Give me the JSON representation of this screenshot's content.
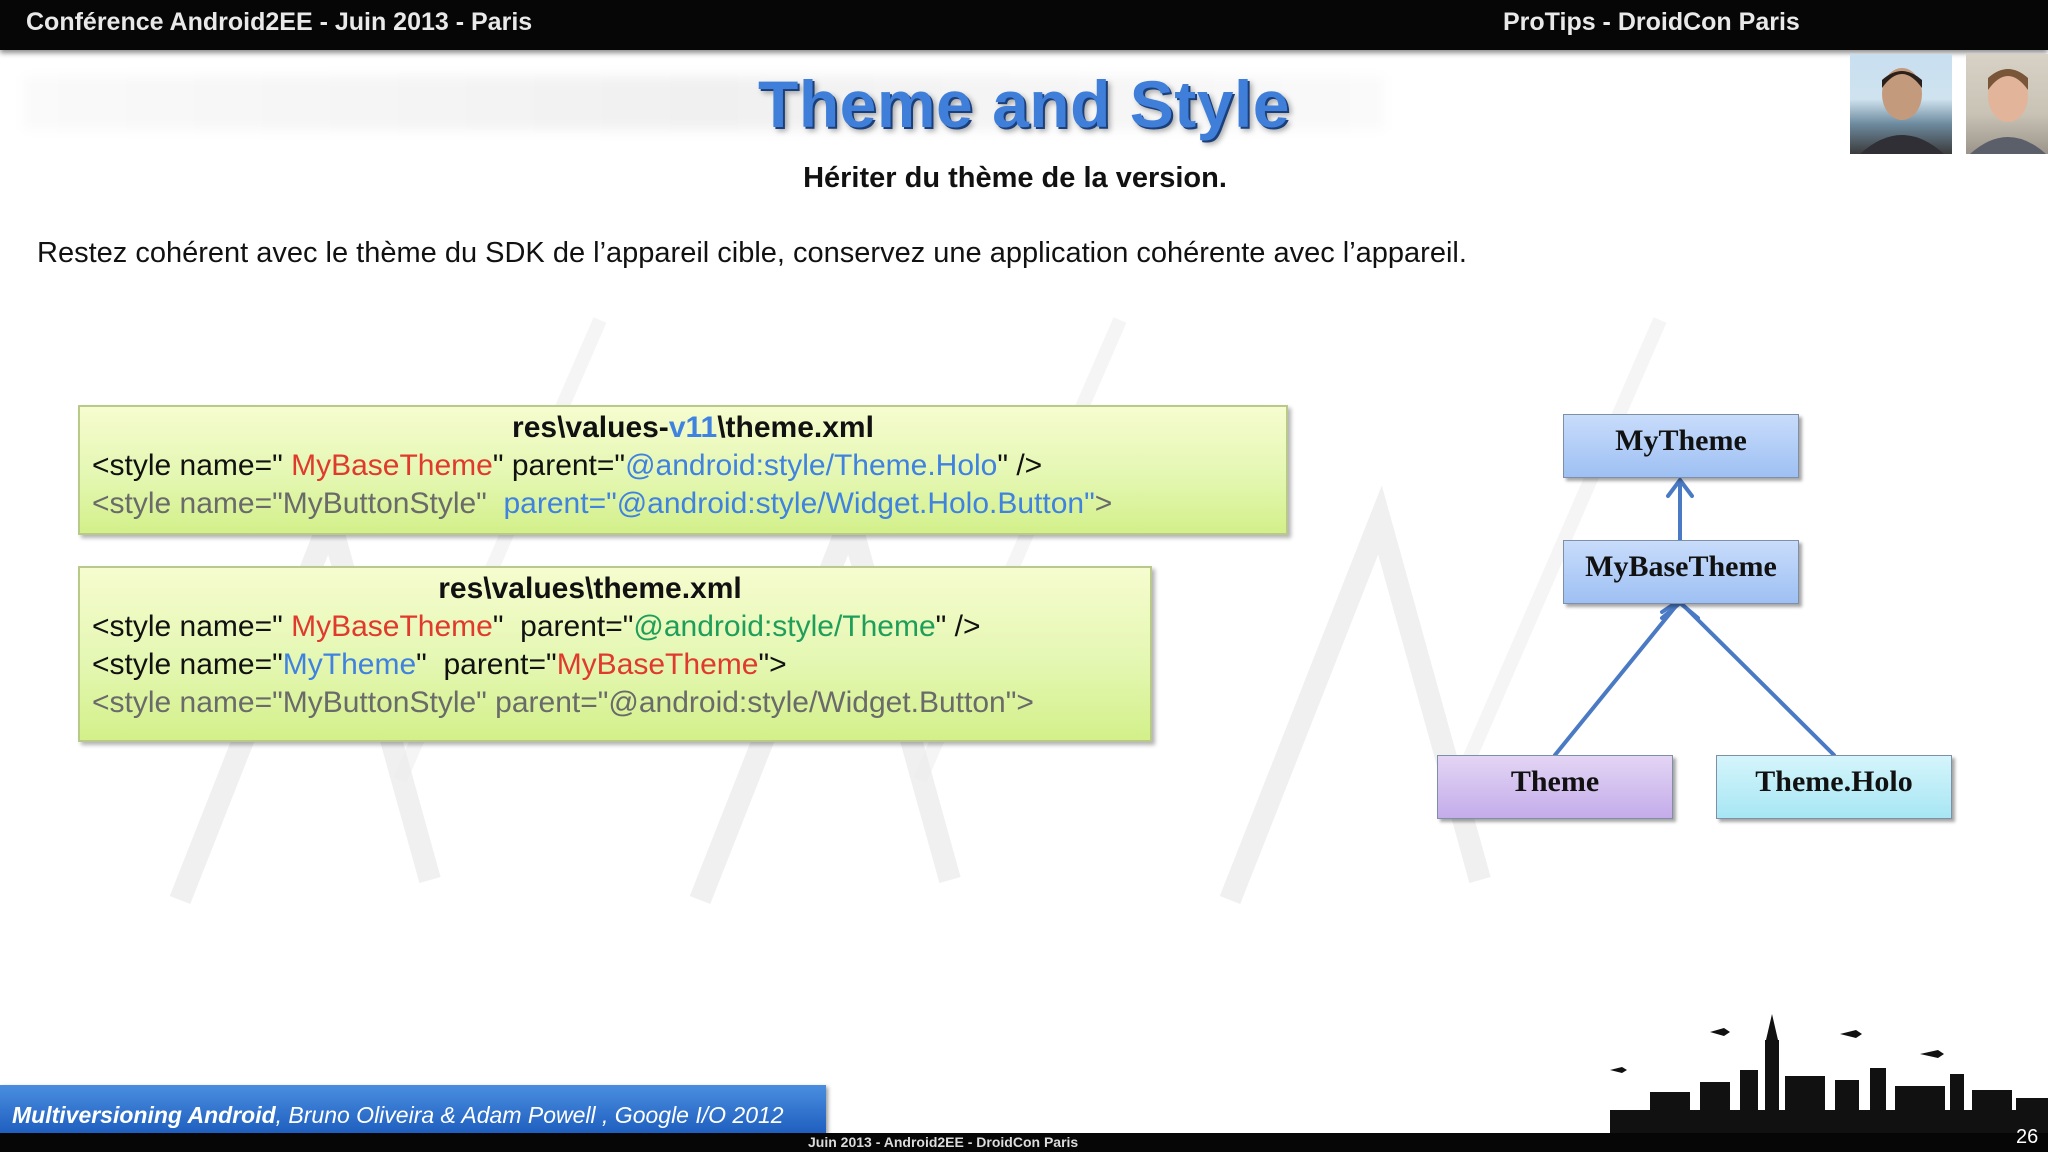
{
  "header": {
    "left": "Conférence Android2EE -  Juin 2013 - Paris",
    "right": "ProTips - DroidCon Paris"
  },
  "slide": {
    "title": "Theme and Style",
    "subtitle": "Hériter du thème de la version.",
    "intro": "Restez cohérent avec le thème du SDK de l’appareil cible, conservez une application cohérente avec l’appareil."
  },
  "box1": {
    "title_a": "res\\values-",
    "title_b": "v11",
    "title_c": "\\theme.xml",
    "l1_a": "<style name=\" ",
    "l1_b": "MyBaseTheme",
    "l1_c": "\" parent=\"",
    "l1_d": "@android:style/Theme.Holo",
    "l1_e": "\" />",
    "l2_a": "<style name=\"MyButtonStyle\"  ",
    "l2_b": "parent=\"@android:style/Widget.Holo.Button\"",
    "l2_c": ">"
  },
  "box2": {
    "title": "res\\values\\theme.xml",
    "l1_a": "<style name=\" ",
    "l1_b": "MyBaseTheme",
    "l1_c": "\"  parent=\"",
    "l1_d": "@android:style/Theme",
    "l1_e": "\" />",
    "l2_a": "<style name=\"",
    "l2_b": "MyTheme",
    "l2_c": "\"  parent=\"",
    "l2_d": "MyBaseTheme",
    "l2_e": "\">",
    "l3": "<style name=\"MyButtonStyle\" parent=\"@android:style/Widget.Button\">"
  },
  "diagram": {
    "mytheme": "MyTheme",
    "mybasetheme": "MyBaseTheme",
    "theme": "Theme",
    "holo": "Theme.Holo"
  },
  "footer": {
    "ref_bold": "Multiversioning Android",
    "ref_rest": ", Bruno Oliveira  & Adam Powell , Google I/O 2012",
    "center": "Juin 2013 - Android2EE - DroidCon Paris",
    "page": "26"
  },
  "colors": {
    "title": "#3f7fd9",
    "red": "#e03a2c",
    "blue": "#3f82e0",
    "green": "#1f9e5a",
    "gray": "#6a6a6a",
    "arrow": "#4a7ac4"
  }
}
